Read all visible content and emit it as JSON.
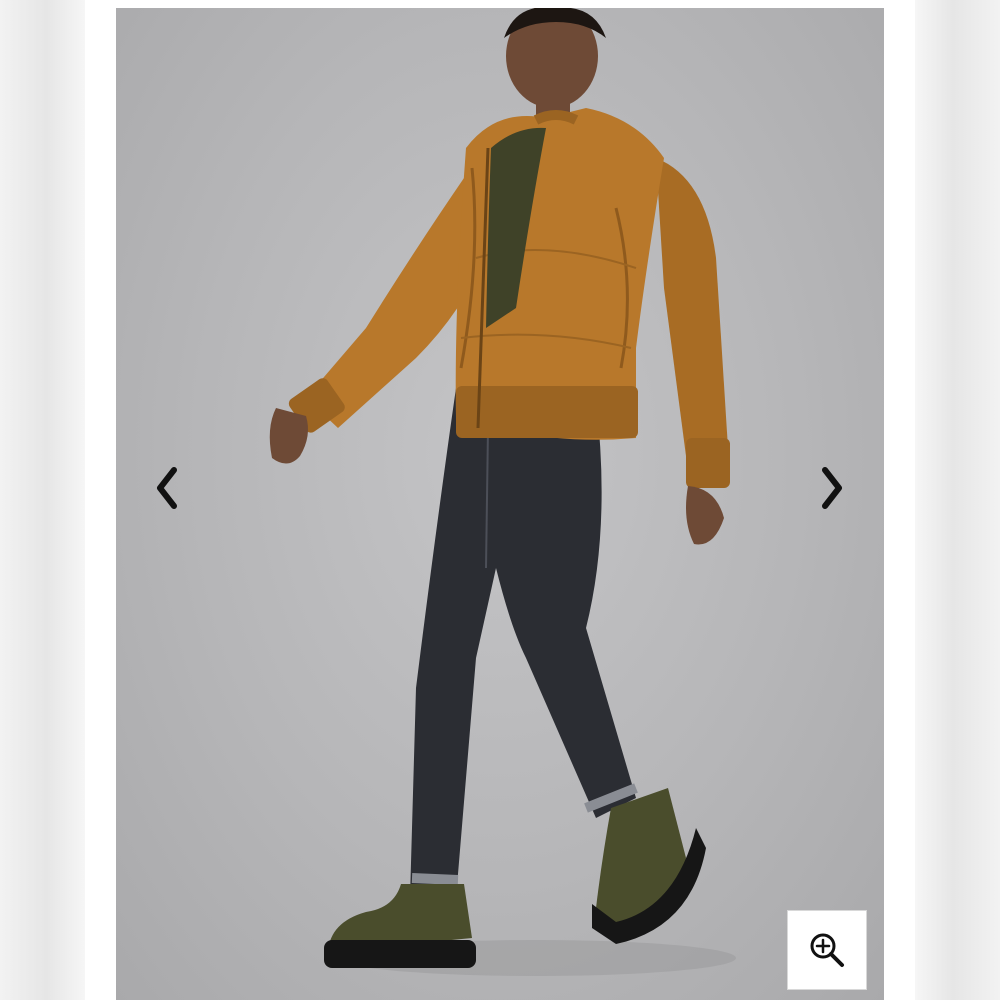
{
  "gallery": {
    "image_alt": "",
    "prev_icon": "chevron-left-icon",
    "next_icon": "chevron-right-icon",
    "zoom_icon": "zoom-in-icon"
  },
  "colors": {
    "backdrop": "#b9b9bb",
    "jacket": "#b8782b",
    "jacket_shadow": "#8f5a1d",
    "top": "#3f4228",
    "jeans": "#2b2d33",
    "boots": "#4a4d2c",
    "sole": "#161616",
    "skin": "#6e4a36",
    "arrow": "#111111"
  }
}
